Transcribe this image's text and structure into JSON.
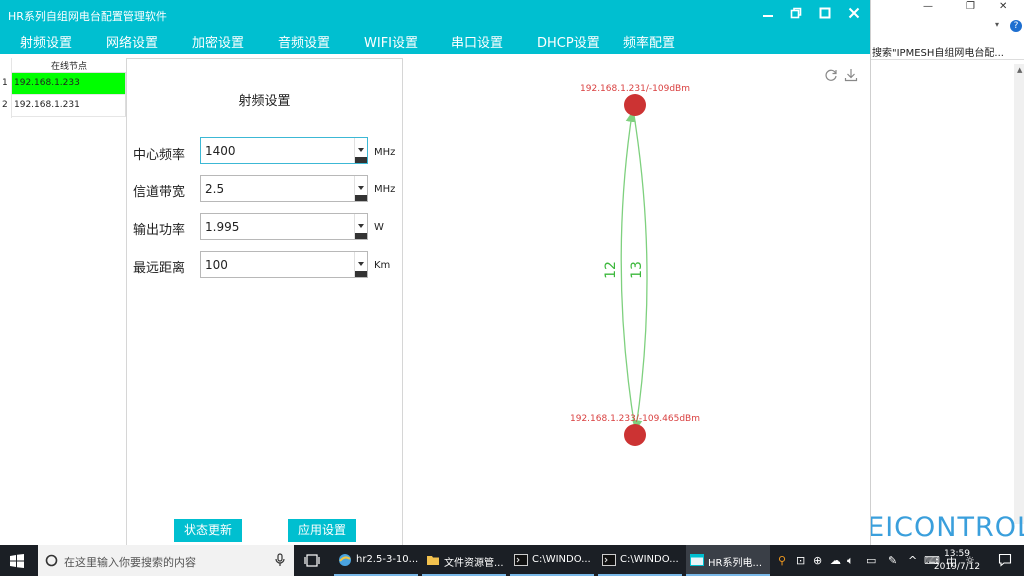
{
  "window": {
    "title": "HR系列自组网电台配置管理软件"
  },
  "menu": [
    "射频设置",
    "网络设置",
    "加密设置",
    "音频设置",
    "WIFI设置",
    "串口设置",
    "DHCP设置",
    "频率配置"
  ],
  "node_list": {
    "header": "在线节点",
    "rows": [
      {
        "index": "1",
        "ip": "192.168.1.233",
        "selected": true
      },
      {
        "index": "2",
        "ip": "192.168.1.231",
        "selected": false
      }
    ]
  },
  "settings": {
    "title": "射频设置",
    "fields": [
      {
        "label": "中心频率",
        "value": "1400",
        "unit": "MHz"
      },
      {
        "label": "信道带宽",
        "value": "2.5",
        "unit": "MHz"
      },
      {
        "label": "输出功率",
        "value": "1.995",
        "unit": "W"
      },
      {
        "label": "最远距离",
        "value": "100",
        "unit": "Km"
      }
    ],
    "refresh_button": "状态更新",
    "apply_button": "应用设置"
  },
  "topology": {
    "node_top_label": "192.168.1.231/-109dBm",
    "node_bottom_label": "192.168.1.233/-109.465dBm",
    "link_left_label": "12",
    "link_right_label": "13",
    "node_color": "#cc3333",
    "link_color": "#7ed07e",
    "label_color": "#d94040"
  },
  "browser": {
    "search_text": "搜索\"IPMESH自组网电台配...",
    "brand": "SEICONTROL"
  },
  "taskbar": {
    "search_placeholder": "在这里输入你要搜索的内容",
    "items": [
      "hr2.5-3-10...",
      "文件资源管...",
      "C:\\WINDO...",
      "C:\\WINDO...",
      "HR系列电..."
    ],
    "ime": "中",
    "time": "13:59",
    "date": "2019/7/12"
  },
  "colors": {
    "accent": "#00bfd0",
    "selected_row": "#00ff00"
  }
}
